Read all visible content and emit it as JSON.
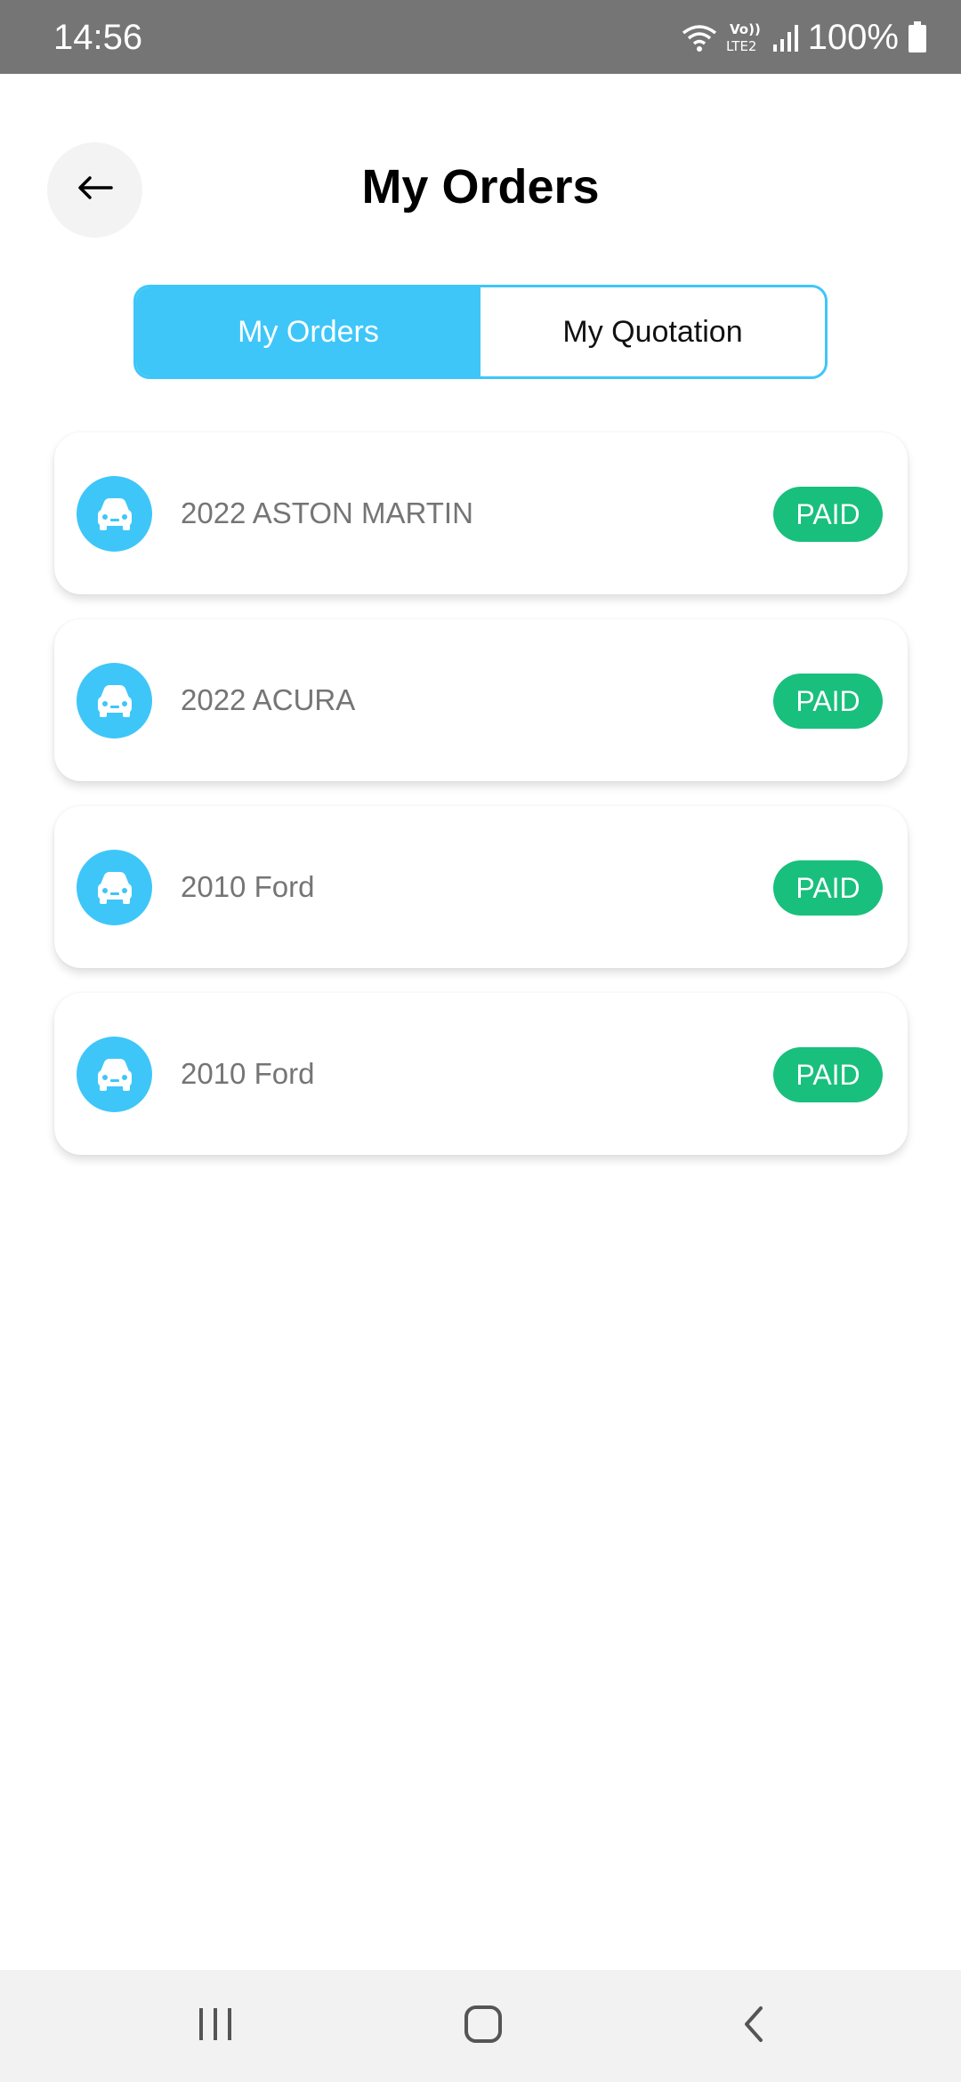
{
  "status_bar": {
    "time": "14:56",
    "battery_text": "100%",
    "icons": [
      "wifi-icon",
      "volte-lte2-icon",
      "signal-icon",
      "battery-icon"
    ]
  },
  "header": {
    "title": "My Orders",
    "back_icon": "arrow-left-icon"
  },
  "tabs": [
    {
      "label": "My Orders",
      "active": true
    },
    {
      "label": "My Quotation",
      "active": false
    }
  ],
  "orders": [
    {
      "title": "2022 ASTON MARTIN",
      "status": "PAID",
      "icon": "car-icon"
    },
    {
      "title": "2022 ACURA",
      "status": "PAID",
      "icon": "car-icon"
    },
    {
      "title": "2010 Ford",
      "status": "PAID",
      "icon": "car-icon"
    },
    {
      "title": "2010 Ford",
      "status": "PAID",
      "icon": "car-icon"
    }
  ],
  "nav_bar": {
    "icons": [
      "recent-apps-icon",
      "home-icon",
      "back-icon"
    ]
  },
  "colors": {
    "accent": "#3ec6f9",
    "paid": "#19bf7d",
    "status_bar": "#757575",
    "nav_bar": "#f2f2f2"
  }
}
